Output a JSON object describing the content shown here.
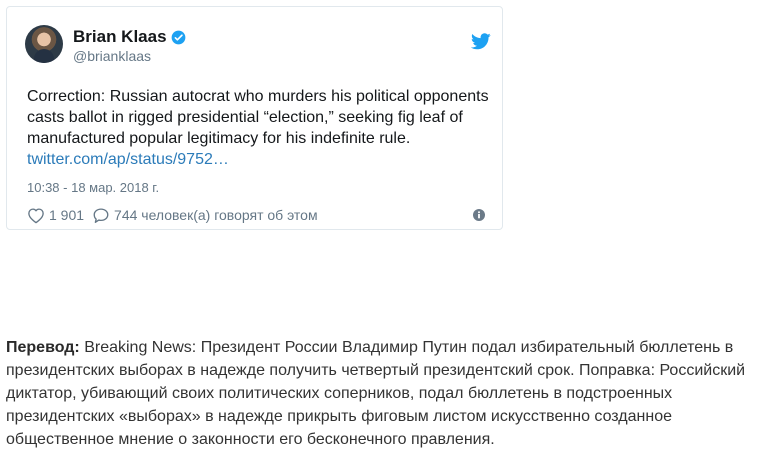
{
  "tweet": {
    "author_name": "Brian Klaas",
    "author_handle": "@brianklaas",
    "text": "Correction: Russian autocrat who murders his political opponents casts ballot in rigged presidential “election,” seeking fig leaf of manufactured popular legitimacy for his indefinite rule.",
    "link": "twitter.com/ap/status/9752…",
    "timestamp": "10:38 - 18 мар. 2018 г.",
    "likes": "1 901",
    "replies_text": "744 человек(а) говорят об этом",
    "icons": {
      "avatar": "avatar",
      "verified": "verified-badge-icon",
      "brand": "twitter-bird-icon",
      "like": "heart-icon",
      "reply": "speech-bubble-icon",
      "info": "info-icon"
    },
    "colors": {
      "brand": "#1da1f2",
      "link": "#2b7bb9",
      "muted": "#657786"
    }
  },
  "translation": {
    "label": "Перевод:",
    "text": " Breaking News: Президент России Владимир Путин подал избирательный бюллетень в президентских выборах в надежде получить четвертый президентский срок. Поправка: Российский диктатор, убивающий своих политических соперников, подал бюллетень в подстроенных президентских «выборах» в надежде прикрыть фиговым листом искусственно созданное общественное мнение о законности его бесконечного правления."
  }
}
